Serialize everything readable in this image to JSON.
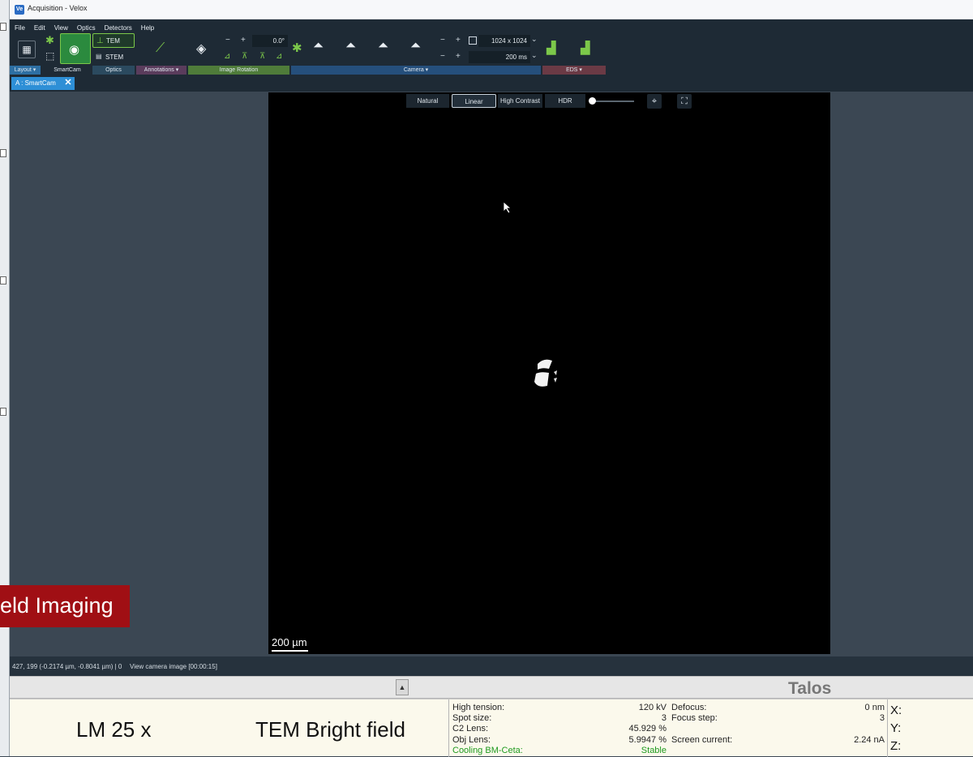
{
  "window": {
    "title": "Acquisition - Velox",
    "app_icon": "Ve"
  },
  "menu": [
    "File",
    "Edit",
    "View",
    "Optics",
    "Detectors",
    "Help"
  ],
  "ribbon": {
    "tem_label": "TEM",
    "stem_label": "STEM",
    "rotation_value": "0.0°",
    "frame_size": "1024 x 1024",
    "exposure": "200 ms"
  },
  "groups": {
    "layout": "Layout ▾",
    "smartcam": "SmartCam",
    "optics": "Optics",
    "annotations": "Annotations ▾",
    "image_rotation": "Image Rotation",
    "camera": "Camera ▾",
    "eds": "EDS ▾"
  },
  "doc_tab": {
    "label": "A : SmartCam",
    "close": "✕"
  },
  "camera_controls": [
    "Natural",
    "Linear",
    "High Contrast",
    "HDR"
  ],
  "scalebar": "200 µm",
  "banner": "eld Imaging",
  "status": {
    "coords": "427, 199 (-0.2174 µm, -0.8041 µm) | 0",
    "message": "View camera image [00:00:15]"
  },
  "talos": {
    "title": "Talos",
    "scroll": "▲"
  },
  "info": {
    "magnification": "LM  25 x",
    "mode": "TEM Bright field",
    "params_left": [
      {
        "label": "High tension:",
        "value": "120 kV"
      },
      {
        "label": "Spot size:",
        "value": "3"
      },
      {
        "label": "C2 Lens:",
        "value": "45.929 %"
      },
      {
        "label": "Obj Lens:",
        "value": "5.9947 %"
      },
      {
        "label": "Cooling BM-Ceta:",
        "value": "Stable"
      }
    ],
    "params_right": [
      {
        "label": "Defocus:",
        "value": "0 nm"
      },
      {
        "label": "Focus step:",
        "value": "3"
      },
      {
        "label": "Screen current:",
        "value": "2.24 nA"
      }
    ],
    "axes": [
      "X:",
      "Y:",
      "Z:"
    ]
  },
  "colors": {
    "chrome": "#1e2a35",
    "viewer_bg": "#3b4753",
    "accent_green": "#7cc84a",
    "tab_blue": "#2e8fd6",
    "banner_red": "#a00f14"
  }
}
